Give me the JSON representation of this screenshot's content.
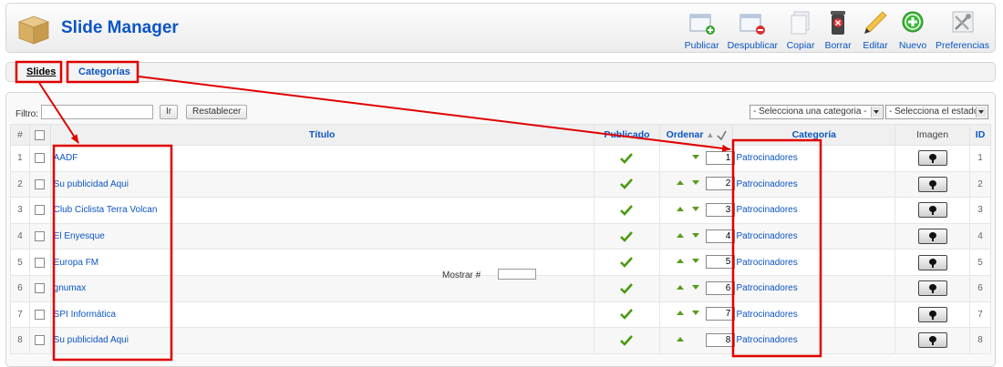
{
  "header": {
    "title": "Slide Manager",
    "toolbar": [
      {
        "label": "Publicar",
        "icon": "publish-icon"
      },
      {
        "label": "Despublicar",
        "icon": "unpublish-icon"
      },
      {
        "label": "Copiar",
        "icon": "copy-icon"
      },
      {
        "label": "Borrar",
        "icon": "trash-icon"
      },
      {
        "label": "Editar",
        "icon": "pencil-icon"
      },
      {
        "label": "Nuevo",
        "icon": "add-icon"
      },
      {
        "label": "Preferencias",
        "icon": "preferences-icon"
      }
    ]
  },
  "subnav": {
    "tabs": [
      {
        "label": "Slides",
        "active": true
      },
      {
        "label": "Categorías",
        "active": false
      }
    ]
  },
  "filter": {
    "label": "Filtro:",
    "value": "",
    "go_label": "Ir",
    "reset_label": "Restablecer",
    "category_select": "- Selecciona una categoria -",
    "state_select": "- Selecciona el estado -"
  },
  "table": {
    "columns": {
      "num": "#",
      "title": "Título",
      "published": "Publicado",
      "order": "Ordenar",
      "category": "Categoría",
      "image": "Imagen",
      "id": "ID"
    },
    "rows": [
      {
        "num": "1",
        "title": "AADF",
        "published": true,
        "order": "1",
        "category": "Patrocinadores",
        "id": "1"
      },
      {
        "num": "2",
        "title": "Su publicidad Aqui",
        "published": true,
        "order": "2",
        "category": "Patrocinadores",
        "id": "2"
      },
      {
        "num": "3",
        "title": "Club Ciclista Terra Volcan",
        "published": true,
        "order": "3",
        "category": "Patrocinadores",
        "id": "3"
      },
      {
        "num": "4",
        "title": "El Enyesque",
        "published": true,
        "order": "4",
        "category": "Patrocinadores",
        "id": "4"
      },
      {
        "num": "5",
        "title": "Europa FM",
        "published": true,
        "order": "5",
        "category": "Patrocinadores",
        "id": "5"
      },
      {
        "num": "6",
        "title": "gnumax",
        "published": true,
        "order": "6",
        "category": "Patrocinadores",
        "id": "6"
      },
      {
        "num": "7",
        "title": "SPI Informática",
        "published": true,
        "order": "7",
        "category": "Patrocinadores",
        "id": "7"
      },
      {
        "num": "8",
        "title": "Su publicidad Aqui",
        "published": true,
        "order": "8",
        "category": "Patrocinadores",
        "id": "8"
      }
    ]
  },
  "pagination": {
    "label": "Mostrar #"
  },
  "colors": {
    "link": "#0B55C4",
    "annotation": "#e00000",
    "check": "#4a9a10"
  }
}
